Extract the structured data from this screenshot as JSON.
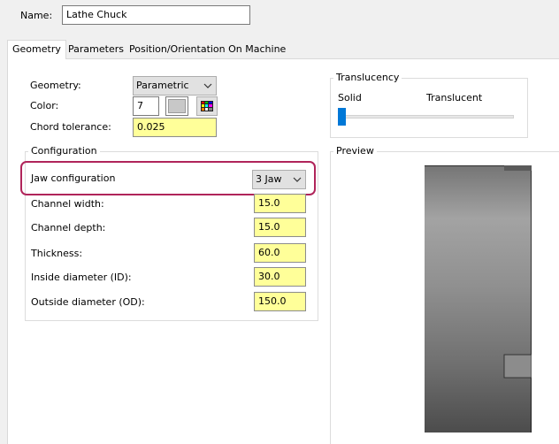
{
  "name": {
    "label": "Name:",
    "value": "Lathe Chuck"
  },
  "tabs": [
    {
      "label": "Geometry",
      "active": true
    },
    {
      "label": "Parameters",
      "active": false
    },
    {
      "label": "Position/Orientation On Machine",
      "active": false
    }
  ],
  "geometry": {
    "geometry_label": "Geometry:",
    "geometry_value": "Parametric",
    "color_label": "Color:",
    "color_value": "7",
    "color_swatch": "#c8c8c8",
    "chord_label": "Chord tolerance:",
    "chord_value": "0.025"
  },
  "configuration": {
    "title": "Configuration",
    "jaw_label": "Jaw configuration",
    "jaw_value": "3 Jaw",
    "fields": [
      {
        "label": "Channel width:",
        "value": "15.0"
      },
      {
        "label": "Channel depth:",
        "value": "15.0"
      },
      {
        "label": "Thickness:",
        "value": "60.0"
      },
      {
        "label": "Inside diameter (ID):",
        "value": "30.0"
      },
      {
        "label": "Outside diameter (OD):",
        "value": "150.0"
      }
    ]
  },
  "translucency": {
    "title": "Translucency",
    "solid_label": "Solid",
    "translucent_label": "Translucent",
    "level": 0
  },
  "preview": {
    "title": "Preview"
  },
  "colors": {
    "highlight": "#b0245a",
    "input_yellow": "#ffff99",
    "slider_accent": "#0078d7"
  }
}
